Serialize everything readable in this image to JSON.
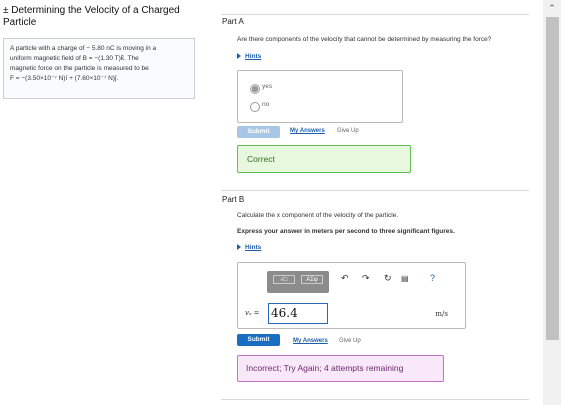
{
  "left": {
    "title": "± Determining the Velocity of a Charged Particle",
    "problem_lines": [
      "A particle with a charge of − 5.80 nC is moving in a",
      "uniform magnetic field of B = −(1.30 T)k̂. The",
      "magnetic force on the particle is measured to be",
      "F = −(3.50×10⁻⁷ N)î + (7.60×10⁻⁷ N)ĵ."
    ]
  },
  "partA": {
    "title": "Part A",
    "question": "Are there components of the velocity that cannot be determined by measuring the force?",
    "hints_label": "Hints",
    "choices": [
      "yes",
      "no"
    ],
    "selected": "yes",
    "submit_label": "Submit",
    "my_answers_label": "My Answers",
    "give_up_label": "Give Up",
    "feedback": "Correct"
  },
  "partB": {
    "title": "Part B",
    "question": "Calculate the x component of the velocity of the particle.",
    "instruction": "Express your answer in meters per second to three significant figures.",
    "hints_label": "Hints",
    "toolbar": {
      "btn1": "√□",
      "btn2": "ΑΣφ"
    },
    "variable_label": "vₓ =",
    "answer_value": "46.4",
    "unit": "m/s",
    "help": "?",
    "submit_label": "Submit",
    "my_answers_label": "My Answers",
    "give_up_label": "Give Up",
    "feedback": "Incorrect; Try Again; 4 attempts remaining"
  },
  "icons": {
    "undo": "undo-icon",
    "redo": "redo-icon",
    "reset": "reset-icon",
    "keyboard": "keyboard-icon",
    "help": "help-icon"
  },
  "colors": {
    "correct_border": "#5fbf4f",
    "incorrect_border": "#c96fc9",
    "submit_active": "#1a6ec2",
    "submit_disabled": "#a8c6e6",
    "link": "#1c5fa8"
  }
}
